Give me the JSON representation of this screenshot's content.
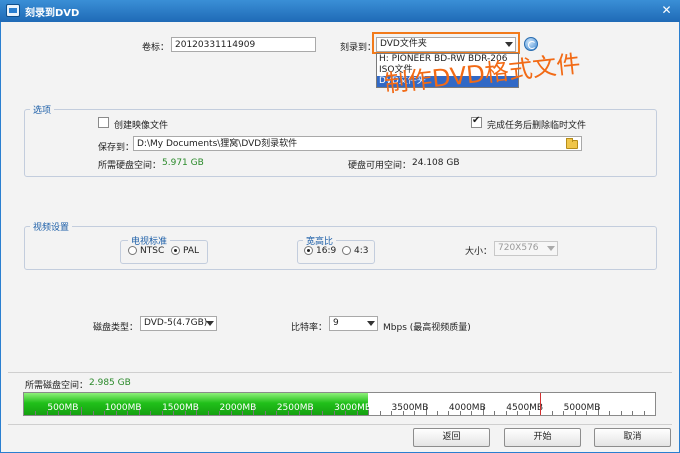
{
  "window": {
    "title": "刻录到DVD",
    "close_glyph": "✕"
  },
  "top": {
    "volume_label": "卷标：",
    "volume_value": "20120331114909",
    "burn_to_label": "刻录到：",
    "burn_to_selected": "DVD文件夹",
    "dropdown_options": [
      "H: PIONEER  BD-RW   BDR-206",
      "ISO文件",
      "DVD文件夹"
    ],
    "dropdown_selected_index": 2
  },
  "annotation": "制作DVD格式文件",
  "options": {
    "group_title": "选项",
    "create_image_label": "创建映像文件",
    "create_image_checked": false,
    "delete_temp_label": "完成任务后删除临时文件",
    "delete_temp_checked": true,
    "save_to_label": "保存到：",
    "save_to_value": "D:\\My Documents\\狸窝\\DVD刻录软件",
    "required_space_label": "所需硬盘空间：",
    "required_space_value": "5.971 GB",
    "available_space_label": "硬盘可用空间：",
    "available_space_value": "24.108 GB"
  },
  "video": {
    "group_title": "视频设置",
    "standard_title": "电视标准",
    "standard_options": [
      "NTSC",
      "PAL"
    ],
    "standard_selected": "PAL",
    "aspect_title": "宽高比",
    "aspect_options": [
      "16:9",
      "4:3"
    ],
    "aspect_selected": "16:9",
    "size_label": "大小：",
    "size_value": "720X576"
  },
  "disc": {
    "type_label": "磁盘类型：",
    "type_value": "DVD-5(4.7GB)",
    "bitrate_label": "比特率：",
    "bitrate_value": "9",
    "bitrate_unit": "Mbps (最高视频质量)"
  },
  "usage": {
    "label": "所需磁盘空间：",
    "value": "2.985 GB",
    "used_mb": 3000,
    "max_mb": 5500,
    "marker_mb": 4500,
    "tick_labels": [
      "500MB",
      "1000MB",
      "1500MB",
      "2000MB",
      "2500MB",
      "3000MB",
      "3500MB",
      "4000MB",
      "4500MB",
      "5000MB"
    ]
  },
  "buttons": {
    "back": "返回",
    "start": "开始",
    "cancel": "取消"
  },
  "colors": {
    "accent": "#2a7fd0",
    "highlight": "#f27a1a",
    "annotation": "#f26a15",
    "fill_green": "#21c01a",
    "value_green": "#2a8a2a"
  }
}
